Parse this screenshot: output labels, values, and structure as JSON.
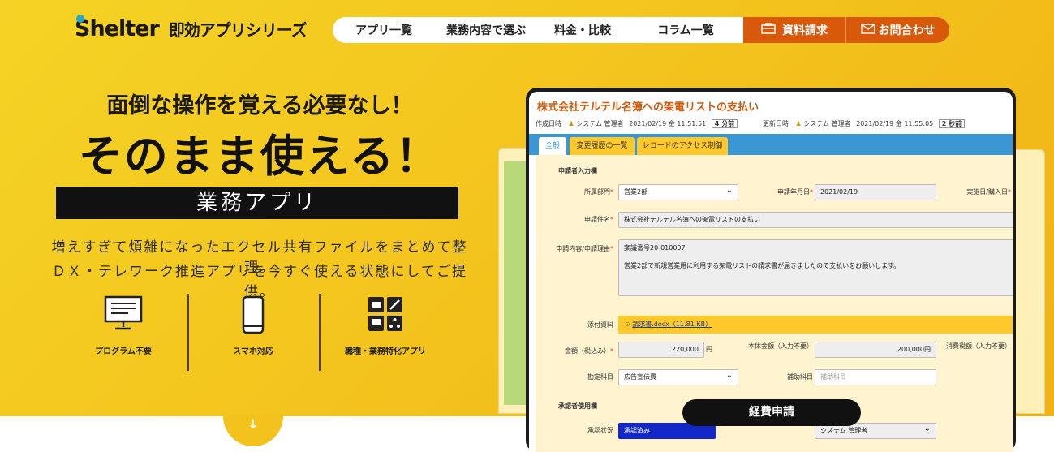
{
  "header": {
    "logo_name": "Shelter",
    "logo_tagline": "即効アプリシリーズ",
    "nav": [
      "アプリ一覧",
      "業務内容で選ぶ",
      "料金・比較",
      "コラム一覧"
    ],
    "cta_docs": "資料請求",
    "cta_contact": "お問合わせ"
  },
  "hero": {
    "headline_small": "面倒な操作を覚える必要なし！",
    "headline_big": "そのまま使える！",
    "band": "業務アプリ",
    "desc_line1": "増えすぎて煩雑になったエクセル共有ファイルをまとめて整理。",
    "desc_line2": "ＤＸ・テレワーク推進アプリを今すぐ使える状態にしてご提供。",
    "features": [
      "プログラム不要",
      "スマホ対応",
      "職種・業務特化アプリ"
    ],
    "scroll_arrow": "↓"
  },
  "record": {
    "title": "株式会社テルテル名簿への架電リストの支払い",
    "created_label": "作成日時",
    "created_user": "システム 管理者",
    "created_at": "2021/02/19 金 11:51:51",
    "created_ago": "4 分前",
    "updated_label": "更新日時",
    "updated_user": "システム 管理者",
    "updated_at": "2021/02/19 金 11:55:05",
    "updated_ago": "2 秒前",
    "tabs": [
      "全般",
      "変更履歴の一覧",
      "レコードのアクセス制御"
    ],
    "section_applicant": "申請者入力欄",
    "dept_label": "所属部門",
    "dept_value": "営業2部",
    "apply_date_label": "申請年月日",
    "apply_date_value": "2021/02/19",
    "exec_date_label": "実施日/購入日",
    "subject_label": "申請件名",
    "subject_value": "株式会社テルテル名簿への架電リストの支払い",
    "reason_label": "申請内容/申請理由",
    "reason_line1": "案議番号20-010007",
    "reason_line2": "営業2部で新規営業用に利用する架電リストの請求書が届きましたので支払いをお願いします。",
    "attach_label": "添付資料",
    "attach_value": "請求書.docx（11.81 KB）",
    "amount_label": "金額（税込み）",
    "amount_value": "220,000",
    "amount_unit": "円",
    "base_label": "本体金額（入力不要）",
    "base_value": "200,000円",
    "tax_label": "消費税額（入力不要）",
    "account_label": "勘定科目",
    "account_value": "広告宣伝費",
    "subaccount_label": "補助科目",
    "subaccount_placeholder": "補助科目",
    "section_approver": "承認者使用欄",
    "approval_label": "承認状況",
    "approval_value": "承認済み",
    "approver_value": "システム 管理者"
  },
  "badge": "経費申請",
  "colors": {
    "accent": "#d8590a",
    "hero_yellow": "#f3c21c",
    "tab_blue": "#3a97d4",
    "title_orange": "#d05a0d"
  }
}
